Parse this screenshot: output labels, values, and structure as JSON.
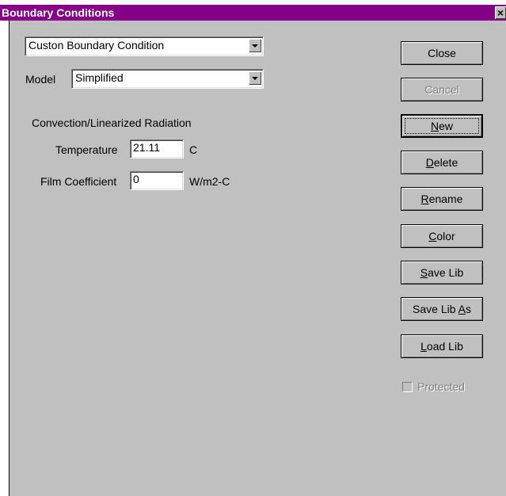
{
  "window": {
    "title": "Boundary Conditions",
    "close_glyph": "×"
  },
  "condition_select": {
    "value": "Custon Boundary Condition"
  },
  "model": {
    "label": "Model",
    "value": "Simplified"
  },
  "section": {
    "heading": "Convection/Linearized Radiation"
  },
  "temperature": {
    "label": "Temperature",
    "value": "21.11",
    "unit": "C"
  },
  "film": {
    "label": "Film Coefficient",
    "value": "0",
    "unit": "W/m2-C"
  },
  "buttons": {
    "close": "Close",
    "cancel": "Cancel",
    "new_pre": "",
    "new_key": "N",
    "new_post": "ew",
    "delete_pre": "",
    "delete_key": "D",
    "delete_post": "elete",
    "rename_pre": "",
    "rename_key": "R",
    "rename_post": "ename",
    "color_pre": "",
    "color_key": "C",
    "color_post": "olor",
    "savelib_pre": "",
    "savelib_key": "S",
    "savelib_post": "ave Lib",
    "savelibas_pre": "Save Lib ",
    "savelibas_key": "A",
    "savelibas_post": "s",
    "loadlib_pre": "",
    "loadlib_key": "L",
    "loadlib_post": "oad Lib"
  },
  "protected": {
    "label": "Protected",
    "checked": false
  },
  "colors": {
    "titlebar": "#840084",
    "face": "#c0c0c0"
  }
}
